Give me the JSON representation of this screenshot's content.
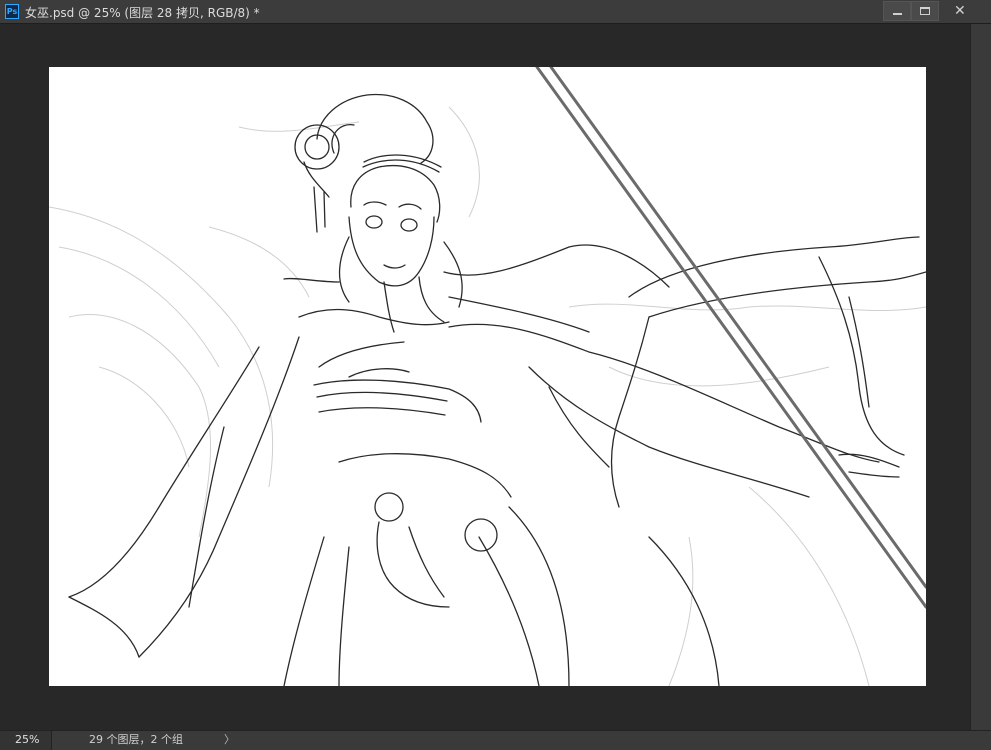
{
  "window": {
    "app_icon": "photoshop-icon",
    "title": "女巫.psd @ 25% (图层 28 拷贝, RGB/8) *",
    "controls": {
      "minimize": "minimize-icon",
      "maximize": "maximize-icon",
      "close": "close-icon",
      "close_glyph": "✕"
    }
  },
  "app_icon_text": "Ps",
  "canvas": {
    "content": "line-art sketch of a robed female figure with a staff",
    "background_color": "#ffffff"
  },
  "status": {
    "zoom": "25%",
    "doc_info": "29 个图层，2 个组",
    "arrow": "〉"
  },
  "colors": {
    "workspace": "#282828",
    "titlebar": "#3c3c3c",
    "statusbar": "#3a3a3a",
    "accent": "#31a8ff"
  }
}
